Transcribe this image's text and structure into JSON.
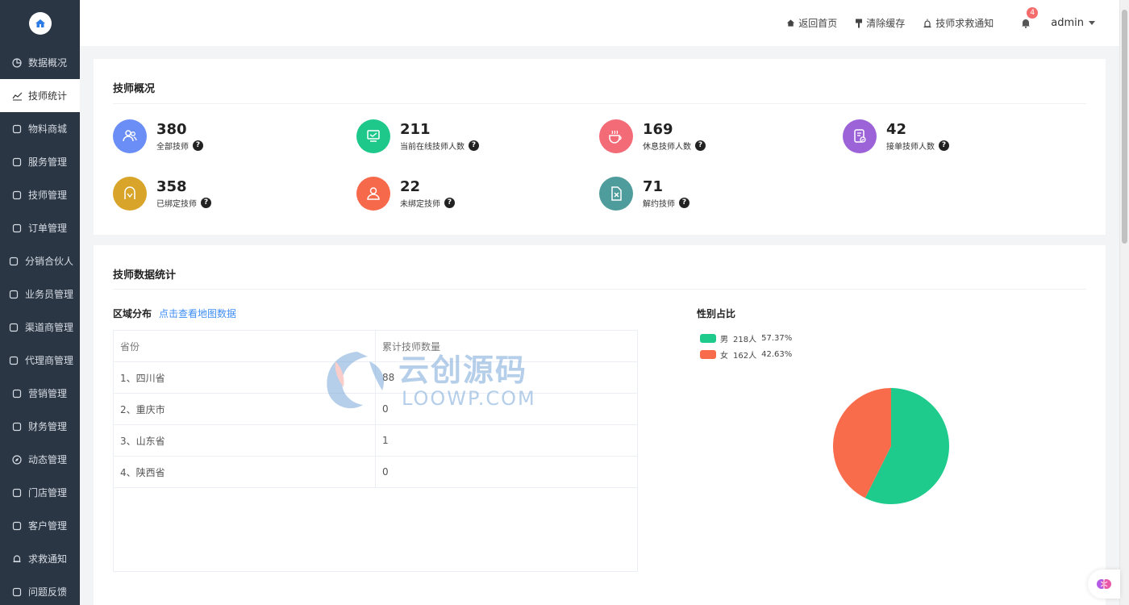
{
  "sidebar": {
    "items": [
      {
        "label": "数据概况",
        "icon": "pie-icon"
      },
      {
        "label": "技师统计",
        "icon": "chart-icon",
        "active": true
      },
      {
        "label": "物料商城",
        "icon": "bag-icon"
      },
      {
        "label": "服务管理",
        "icon": "service-icon"
      },
      {
        "label": "技师管理",
        "icon": "tech-icon"
      },
      {
        "label": "订单管理",
        "icon": "order-icon"
      },
      {
        "label": "分销合伙人",
        "icon": "partner-icon"
      },
      {
        "label": "业务员管理",
        "icon": "salesman-icon"
      },
      {
        "label": "渠道商管理",
        "icon": "channel-icon"
      },
      {
        "label": "代理商管理",
        "icon": "agent-icon"
      },
      {
        "label": "营销管理",
        "icon": "marketing-icon"
      },
      {
        "label": "财务管理",
        "icon": "finance-icon"
      },
      {
        "label": "动态管理",
        "icon": "compass-icon"
      },
      {
        "label": "门店管理",
        "icon": "store-icon"
      },
      {
        "label": "客户管理",
        "icon": "customer-icon"
      },
      {
        "label": "求救通知",
        "icon": "bell-icon"
      },
      {
        "label": "问题反馈",
        "icon": "feedback-icon"
      }
    ]
  },
  "header": {
    "home": "返回首页",
    "clear_cache": "清除缓存",
    "sos": "技师求救通知",
    "notif_count": "4",
    "user": "admin"
  },
  "overview": {
    "title": "技师概况",
    "stats": [
      {
        "value": "380",
        "label": "全部技师",
        "color": "#6a8ef5"
      },
      {
        "value": "211",
        "label": "当前在线技师人数",
        "color": "#1ec88a"
      },
      {
        "value": "169",
        "label": "休息技师人数",
        "color": "#f46b78"
      },
      {
        "value": "42",
        "label": "接单技师人数",
        "color": "#9c62d8"
      },
      {
        "value": "358",
        "label": "已绑定技师",
        "color": "#d8a52a"
      },
      {
        "value": "22",
        "label": "未绑定技师",
        "color": "#f7694b"
      },
      {
        "value": "71",
        "label": "解约技师",
        "color": "#4f9c9c"
      }
    ]
  },
  "stats_section": {
    "title": "技师数据统计",
    "region_title": "区域分布",
    "map_link": "点击查看地图数据",
    "table": {
      "headers": [
        "省份",
        "累计技师数量"
      ],
      "rows": [
        [
          "1、四川省",
          "88"
        ],
        [
          "2、重庆市",
          "0"
        ],
        [
          "3、山东省",
          "1"
        ],
        [
          "4、陕西省",
          "0"
        ]
      ]
    },
    "gender_title": "性别占比"
  },
  "watermark": {
    "cn": "云创源码",
    "en": "LOOWP.COM"
  },
  "chart_data": {
    "type": "pie",
    "labels": [
      "男",
      "女"
    ],
    "counts": [
      "218人",
      "162人"
    ],
    "percents": [
      "57.37%",
      "42.63%"
    ],
    "values": [
      218,
      162
    ],
    "colors": [
      "#1ecb8c",
      "#f96c4b"
    ]
  }
}
